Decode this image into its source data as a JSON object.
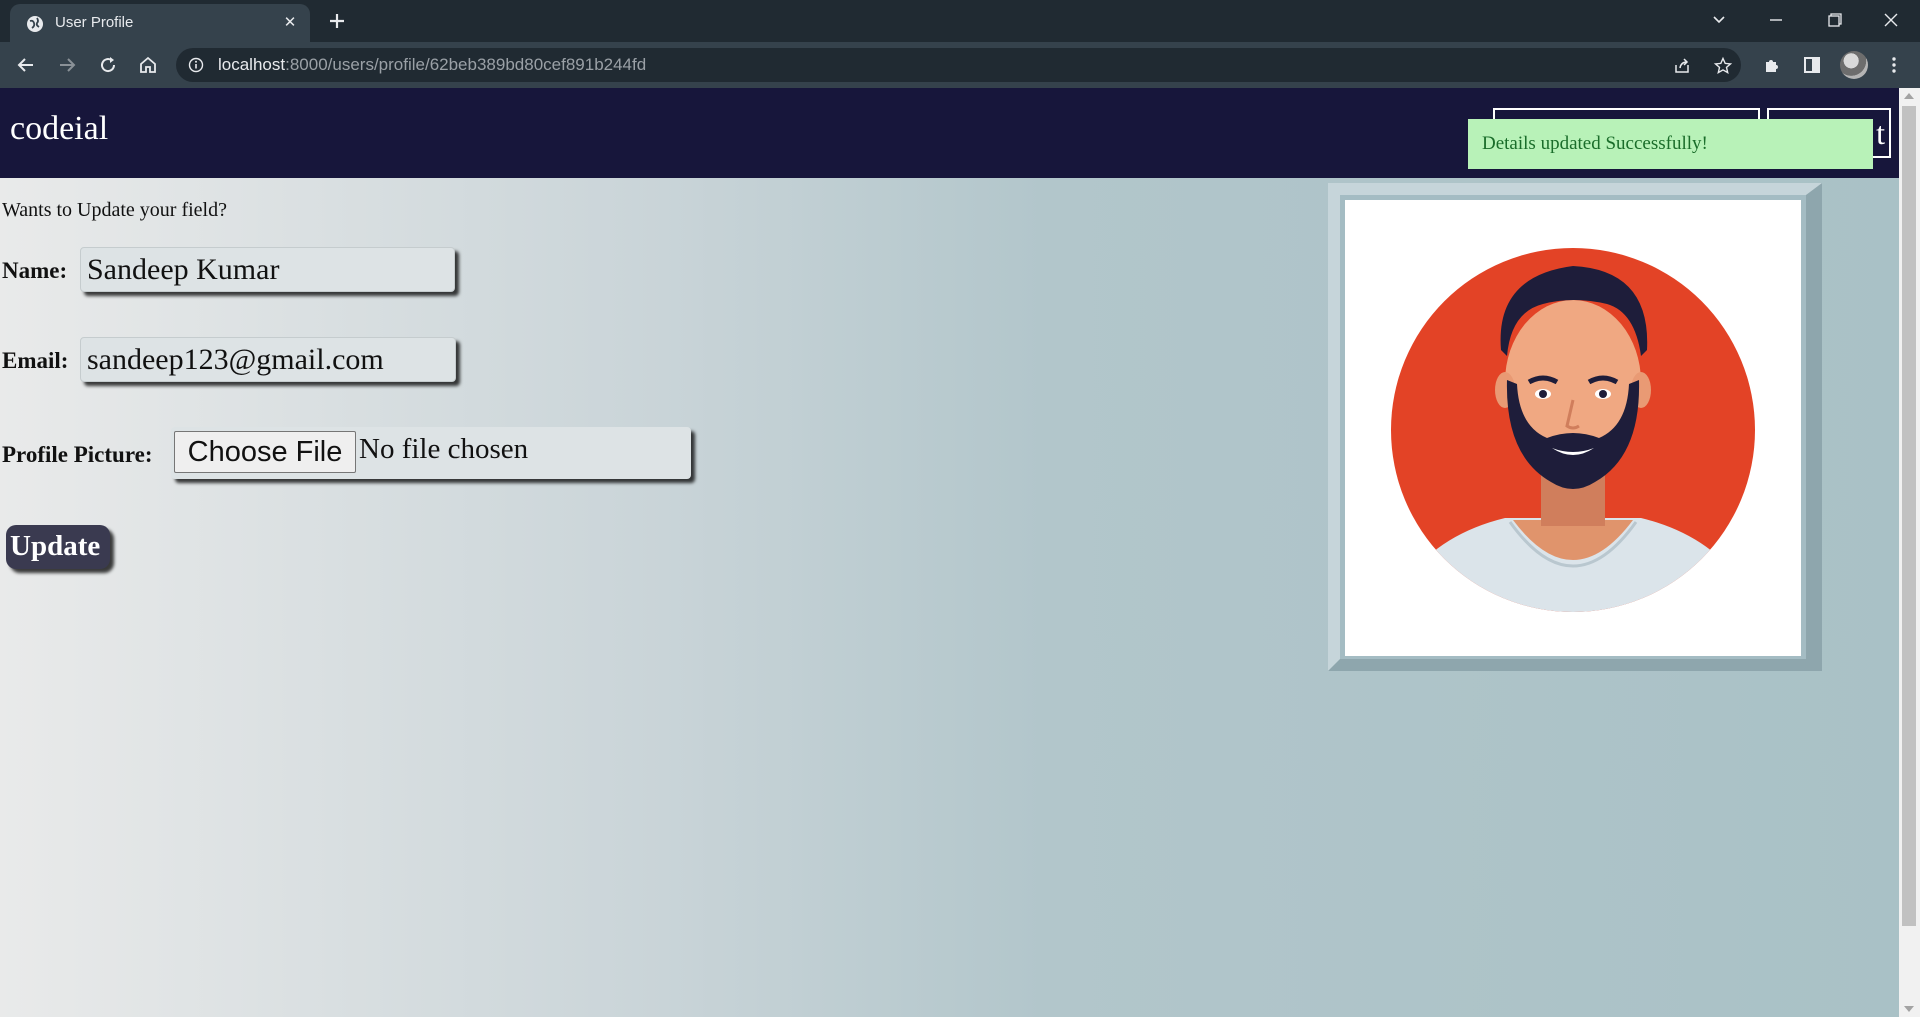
{
  "browser": {
    "tab_title": "User Profile",
    "url_host": "localhost",
    "url_path": ":8000/users/profile/62beb389bd80cef891b244fd"
  },
  "site": {
    "logo": "codeial",
    "nav_right_fragment": "t"
  },
  "toast": {
    "message": "Details updated Successfully!",
    "color": "#b8f2b8"
  },
  "form": {
    "prompt": "Wants to Update your field?",
    "name_label": "Name:",
    "name_value": "Sandeep Kumar",
    "email_label": "Email:",
    "email_value": "sandeep123@gmail.com",
    "picture_label": "Profile Picture:",
    "choose_file_label": "Choose File",
    "file_status": "No file chosen",
    "update_label": "Update"
  },
  "colors": {
    "header_bg": "#17163b",
    "avatar_circle": "#e34326"
  },
  "icons": [
    "globe-icon",
    "close-icon",
    "plus-icon",
    "back-icon",
    "forward-icon",
    "reload-icon",
    "home-icon",
    "info-icon",
    "share-icon",
    "star-icon",
    "puzzle-icon",
    "side-panel-icon",
    "menu-icon"
  ]
}
